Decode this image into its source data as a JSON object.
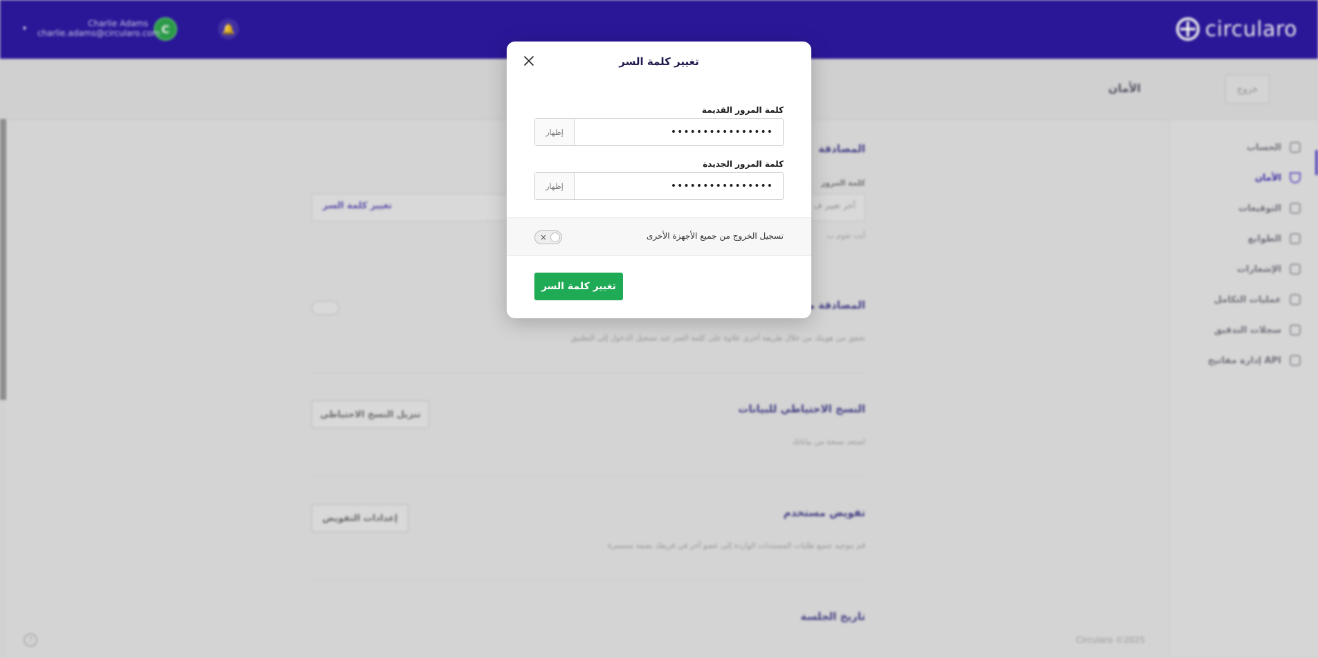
{
  "topbar": {
    "brand_name": "circularo",
    "user_name": "Charlie Adams",
    "user_email": "charlie.adams@circularo.com",
    "avatar_initial": "C",
    "caret_icon": "▾",
    "bell_icon": "🔔",
    "brand_color": "#2e19a5"
  },
  "header": {
    "page_title": "الأمان",
    "logout_label": "خروج"
  },
  "sidebar": {
    "items": [
      {
        "label": "الحساب",
        "icon": "user-icon"
      },
      {
        "label": "الأمان",
        "icon": "shield-icon",
        "active": true
      },
      {
        "label": "التوقيعات",
        "icon": "pen-icon"
      },
      {
        "label": "الطوابع",
        "icon": "stamp-icon"
      },
      {
        "label": "الإشعارات",
        "icon": "bell-icon"
      },
      {
        "label": "عمليات التكامل",
        "icon": "integration-icon"
      },
      {
        "label": "سجلات التدقيق",
        "icon": "audit-log-icon"
      },
      {
        "label": "إدارة مفاتيح API",
        "icon": "key-icon"
      }
    ]
  },
  "background": {
    "auth_title": "المصادقة",
    "password_label": "كلمة المرور",
    "password_field_text": "آخر تغيير ف",
    "change_password_link": "تغيير كلمة السر",
    "password_info": "أنت تقوم ب",
    "mfa_title": "المصادقة متع",
    "mfa_desc": "تحقق من هويتك من خلال طريقة أخرى علاوة على كلمة السر عند تسجيل الدخول إلى التطبيق",
    "backup_title": "النسخ الاحتياطي للبيانات",
    "backup_desc": "استعد نسخة من بياناتك",
    "backup_button": "تنزيل النسخ الاحتياطي",
    "delegate_title": "تفويض مستخدم",
    "delegate_desc": "قم بتوجيه جميع طلبات المستندات الواردة إلى عضو آخر في فريقك بصفة مستمرة",
    "delegate_button": "إعدادات التفويض",
    "session_title": "تاريخ الجلسة",
    "footer_copy": "Circularo ©2025",
    "help_icon": "?"
  },
  "modal": {
    "title": "تغيير كلمة السر",
    "close_icon": "close-icon",
    "old_password_label": "كلمة المرور القديمة",
    "old_password_value": "••••••••••••••••",
    "new_password_label": "كلمة المرور الجديدة",
    "new_password_value": "••••••••••••••••",
    "show_label": "إظهار",
    "logout_all_label": "تسجيل الخروج من جميع الأجهزة الأخرى",
    "toggle_off_glyph": "×",
    "submit_label": "تغيير كلمة السر",
    "submit_color": "#1faa55"
  }
}
